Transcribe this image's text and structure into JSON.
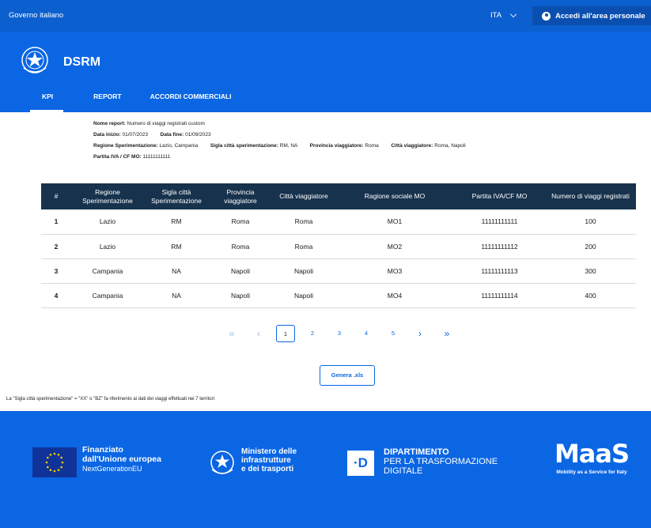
{
  "topbar": {
    "gov_label": "Governo italiano",
    "language": "ITA",
    "login_label": "Accedi all'area personale"
  },
  "header": {
    "title": "DSRM",
    "tabs": [
      {
        "label": "KPI",
        "active": true
      },
      {
        "label": "REPORT",
        "active": false
      },
      {
        "label": "ACCORDI COMMERCIALI",
        "active": false
      }
    ]
  },
  "report": {
    "name_label": "Nome report:",
    "name_value": "Numero di viaggi registrati custom",
    "start_label": "Data inizio:",
    "start_value": "01/07/2023",
    "end_label": "Data fine:",
    "end_value": "01/09/2023",
    "region_label": "Regione Sperimentazione:",
    "region_value": "Lazio, Campania",
    "city_code_label": "Sigla città sperimentazione:",
    "city_code_value": "RM, NA",
    "province_label": "Provincia viaggiatore:",
    "province_value": "Roma",
    "city_label": "Città viaggiatore:",
    "city_value": "Roma, Napoli",
    "vat_label": "Partita IVA / CF MO:",
    "vat_value": "11111111111"
  },
  "table": {
    "headers": [
      "#",
      "Regione Sperimentazione",
      "Sigla città Sperimentazione",
      "Provincia viaggiatore",
      "Città viaggiatore",
      "Ragione sociale MO",
      "Partita IVA/CF MO",
      "Numero di viaggi registrati"
    ],
    "rows": [
      [
        "1",
        "Lazio",
        "RM",
        "Roma",
        "Roma",
        "MO1",
        "11111111111",
        "100"
      ],
      [
        "2",
        "Lazio",
        "RM",
        "Roma",
        "Roma",
        "MO2",
        "11111111112",
        "200"
      ],
      [
        "3",
        "Campania",
        "NA",
        "Napoli",
        "Napoli",
        "MO3",
        "11111111113",
        "300"
      ],
      [
        "4",
        "Campania",
        "NA",
        "Napoli",
        "Napoli",
        "MO4",
        "11111111114",
        "400"
      ]
    ]
  },
  "pagination": {
    "first": "«",
    "prev": "‹",
    "pages": [
      "1",
      "2",
      "3",
      "4",
      "5"
    ],
    "current": "1",
    "next": "›",
    "last": "»"
  },
  "actions": {
    "export_label": "Genera .xls"
  },
  "footnote": "La \"Sigla città sperimentazione\" = \"XX\" o \"BZ\" fa riferimento ai dati dei viaggi effettuati nei 7 territori",
  "footer": {
    "eu_line1": "Finanziato",
    "eu_line2": "dall'Unione europea",
    "eu_line3": "NextGenerationEU",
    "mit_line1": "Ministero delle",
    "mit_line2": "infrastrutture",
    "mit_line3": "e dei trasporti",
    "dtd_letter": "·D",
    "dtd_line1": "DIPARTIMENTO",
    "dtd_line2": "PER LA TRASFORMAZIONE",
    "dtd_line3": "DIGITALE",
    "maas_word": "MaaS",
    "maas_sub": "Mobility as a Service for Italy"
  },
  "colors": {
    "primary": "#0b66e4",
    "topbar": "#0b5fcf",
    "table_header": "#17324d"
  }
}
